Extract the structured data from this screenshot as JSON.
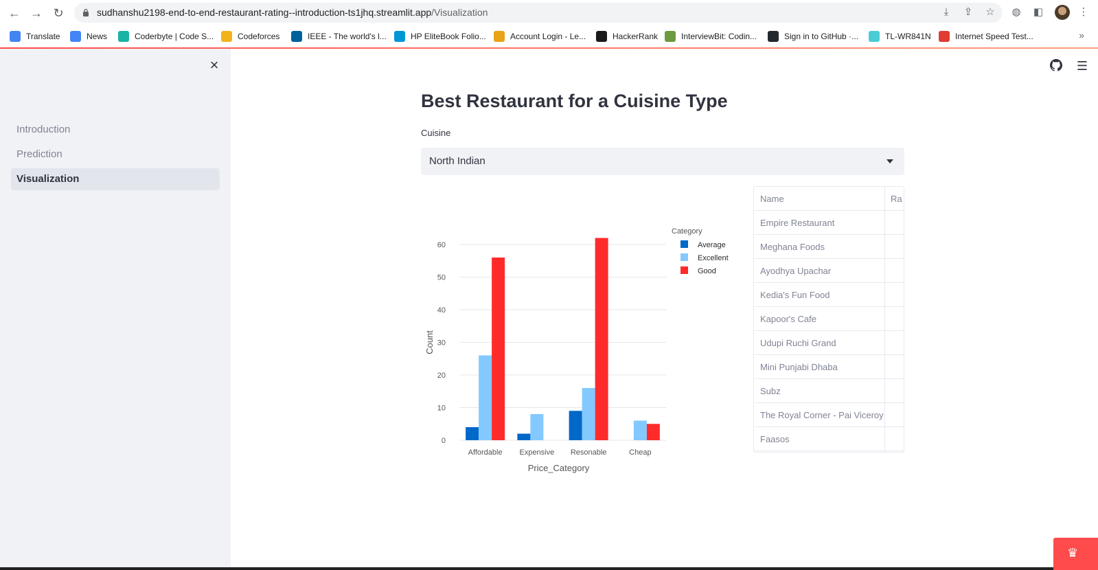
{
  "browser": {
    "url_host": "sudhanshu2198-end-to-end-restaurant-rating--introduction-ts1jhq.streamlit.app",
    "url_path": "/Visualization",
    "bookmarks": [
      {
        "label": "Translate",
        "color": "#4285f4"
      },
      {
        "label": "News",
        "color": "#4285f4"
      },
      {
        "label": "Coderbyte | Code S...",
        "color": "#1bb3a4"
      },
      {
        "label": "Codeforces",
        "color": "#f2b31a"
      },
      {
        "label": "IEEE - The world's l...",
        "color": "#00629b"
      },
      {
        "label": "HP EliteBook Folio...",
        "color": "#0096d6"
      },
      {
        "label": "Account Login - Le...",
        "color": "#e8a317"
      },
      {
        "label": "HackerRank",
        "color": "#1a1a1a"
      },
      {
        "label": "InterviewBit: Codin...",
        "color": "#6c9a3f"
      },
      {
        "label": "Sign in to GitHub ·...",
        "color": "#24292e"
      },
      {
        "label": "TL-WR841N",
        "color": "#4acbd6"
      },
      {
        "label": "Internet Speed Test...",
        "color": "#e03c31"
      }
    ],
    "more": "»"
  },
  "sidebar": {
    "close_icon": "×",
    "items": [
      {
        "label": "Introduction",
        "active": false
      },
      {
        "label": "Prediction",
        "active": false
      },
      {
        "label": "Visualization",
        "active": true
      }
    ]
  },
  "main": {
    "title": "Best Restaurant for a Cuisine Type",
    "select_label": "Cuisine",
    "select_value": "North Indian"
  },
  "chart_data": {
    "type": "bar",
    "categories": [
      "Affordable",
      "Expensive",
      "Resonable",
      "Cheap"
    ],
    "series": [
      {
        "name": "Average",
        "color": "#0068c9",
        "values": [
          4,
          2,
          9,
          0
        ]
      },
      {
        "name": "Excellent",
        "color": "#83c9ff",
        "values": [
          26,
          8,
          16,
          6
        ]
      },
      {
        "name": "Good",
        "color": "#ff2b2b",
        "values": [
          56,
          0,
          62,
          5
        ]
      }
    ],
    "legend_title": "Category",
    "xlabel": "Price_Category",
    "ylabel": "Count",
    "ylim": [
      0,
      62
    ],
    "yticks": [
      0,
      10,
      20,
      30,
      40,
      50,
      60
    ]
  },
  "table": {
    "columns": [
      "Name",
      "Ra"
    ],
    "rows": [
      "Empire Restaurant",
      "Meghana Foods",
      "Ayodhya Upachar",
      "Kedia's Fun Food",
      "Kapoor's Cafe",
      "Udupi Ruchi Grand",
      "Mini Punjabi Dhaba",
      "Subz",
      "The Royal Corner - Pai Viceroy",
      "Faasos"
    ]
  }
}
